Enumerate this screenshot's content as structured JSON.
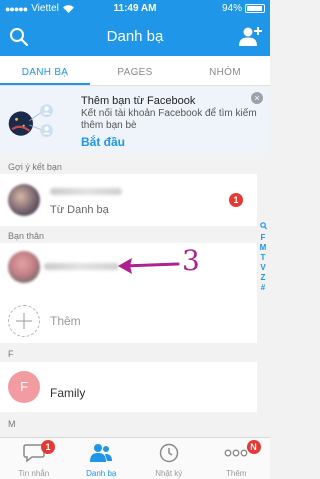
{
  "status": {
    "carrier": "Viettel",
    "time": "11:49 AM",
    "battery": "94%"
  },
  "header": {
    "title": "Danh bạ"
  },
  "tabs": [
    {
      "label": "DANH BẠ",
      "active": true
    },
    {
      "label": "PAGES",
      "active": false
    },
    {
      "label": "NHÓM",
      "active": false
    }
  ],
  "facebook_card": {
    "title": "Thêm bạn từ Facebook",
    "description": "Kết nối tài khoản Facebook để tìm kiếm thêm bạn bè",
    "action": "Bắt đầu",
    "close_icon": "×"
  },
  "suggest": {
    "header": "Gợi ý kết bạn",
    "source": "Từ Danh bạ",
    "badge": "1"
  },
  "close_friends": {
    "header": "Bạn thân",
    "annotation": "3",
    "add_label": "Thêm"
  },
  "groups": [
    {
      "letter": "F",
      "contacts": [
        {
          "initial": "F",
          "name": "Family"
        }
      ]
    },
    {
      "letter": "M",
      "contacts": []
    }
  ],
  "alphabet_index": [
    "Q",
    "F",
    "M",
    "T",
    "V",
    "Z",
    "#"
  ],
  "bottom_tabs": [
    {
      "label": "Tin nhắn",
      "icon": "chat-icon",
      "badge": "1",
      "active": false
    },
    {
      "label": "Danh bạ",
      "icon": "contacts-icon",
      "badge": "",
      "active": true
    },
    {
      "label": "Nhật ký",
      "icon": "clock-icon",
      "badge": "",
      "active": false
    },
    {
      "label": "Thêm",
      "icon": "more-icon",
      "badge": "N",
      "active": false
    }
  ],
  "colors": {
    "brand": "#1f96e8",
    "badge": "#e53935",
    "annotation": "#b0218f",
    "family_avatar": "#f29ca2"
  }
}
